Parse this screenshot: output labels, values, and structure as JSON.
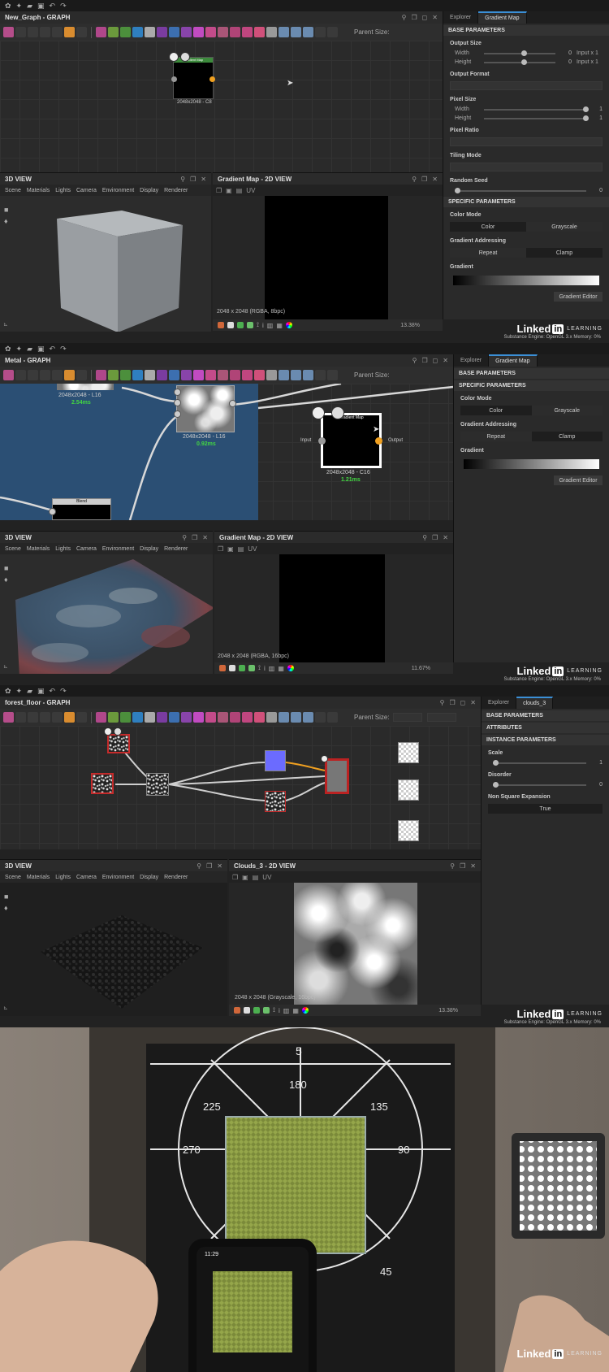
{
  "colors": {
    "accent": "#3b8fd6",
    "timing_green": "#43d643",
    "port_orange": "#f0a020",
    "graph_blue": "#2b4f74"
  },
  "frame1": {
    "graph_title": "New_Graph - GRAPH",
    "parent_size_label": "Parent Size:",
    "node": {
      "label": "2048x2048 - C8",
      "header": "Gradient Map"
    },
    "view3d": {
      "title": "3D VIEW",
      "menu": [
        "Scene",
        "Materials",
        "Lights",
        "Camera",
        "Environment",
        "Display",
        "Renderer"
      ]
    },
    "view2d": {
      "title": "Gradient Map - 2D VIEW",
      "uv": "UV",
      "info": "2048 x 2048 (RGBA, 8bpc)",
      "zoom": "13.38%"
    },
    "panel": {
      "tabs": [
        "Explorer",
        "Gradient Map"
      ],
      "base_params": "BASE PARAMETERS",
      "output_size": "Output Size",
      "width_label": "Width",
      "width_val": "0",
      "width_extra": "Input x 1",
      "height_label": "Height",
      "height_val": "0",
      "height_extra": "Input x 1",
      "output_format": "Output Format",
      "pixel_size": "Pixel Size",
      "px_width_val": "1",
      "px_height_val": "1",
      "pixel_ratio": "Pixel Ratio",
      "tiling_mode": "Tiling Mode",
      "random_seed": "Random Seed",
      "seed_val": "0",
      "specific_params": "SPECIFIC PARAMETERS",
      "color_mode": "Color Mode",
      "color": "Color",
      "grayscale": "Grayscale",
      "gradient_addressing": "Gradient Addressing",
      "repeat": "Repeat",
      "clamp": "Clamp",
      "gradient": "Gradient",
      "gradient_editor": "Gradient Editor"
    },
    "engine": "Substance Engine: OpenGL 3.x  Memory: 0%"
  },
  "frame2": {
    "graph_title": "Metal - GRAPH",
    "parent_size_label": "Parent Size:",
    "node_a_label": "2048x2048 - L16",
    "node_a_time": "2.54ms",
    "node_b_label": "2048x2048 - L16",
    "node_b_time": "0.92ms",
    "node_c_label": "2048x2048 - C16",
    "node_c_time": "1.21ms",
    "node_c_header": "Gradient Map",
    "input_label": "Input",
    "output_label": "Output",
    "blend_node": "Blend",
    "view3d": {
      "title": "3D VIEW",
      "menu": [
        "Scene",
        "Materials",
        "Lights",
        "Camera",
        "Environment",
        "Display",
        "Renderer"
      ]
    },
    "view2d": {
      "title": "Gradient Map - 2D VIEW",
      "uv": "UV",
      "info": "2048 x 2048 (RGBA, 16bpc)",
      "zoom": "11.67%"
    },
    "panel": {
      "tabs": [
        "Explorer",
        "Gradient Map"
      ],
      "base_params": "BASE PARAMETERS",
      "specific_params": "SPECIFIC PARAMETERS",
      "color_mode": "Color Mode",
      "color": "Color",
      "grayscale": "Grayscale",
      "gradient_addressing": "Gradient Addressing",
      "repeat": "Repeat",
      "clamp": "Clamp",
      "gradient": "Gradient",
      "gradient_editor": "Gradient Editor"
    },
    "engine": "Substance Engine: OpenGL 3.x  Memory: 0%"
  },
  "frame3": {
    "graph_title": "forest_floor - GRAPH",
    "parent_size_label": "Parent Size:",
    "view3d": {
      "title": "3D VIEW",
      "menu": [
        "Scene",
        "Materials",
        "Lights",
        "Camera",
        "Environment",
        "Display",
        "Renderer"
      ]
    },
    "view2d": {
      "title": "Clouds_3 - 2D VIEW",
      "uv": "UV",
      "info": "2048 x 2048 (Grayscale, 16bpc)",
      "zoom": "13.38%"
    },
    "panel": {
      "tabs": [
        "Explorer",
        "clouds_3"
      ],
      "base_params": "BASE PARAMETERS",
      "attributes": "ATTRIBUTES",
      "instance_params": "INSTANCE PARAMETERS",
      "scale": "Scale",
      "scale_val": "1",
      "disorder": "Disorder",
      "disorder_val": "0",
      "non_square": "Non Square Expansion",
      "non_square_val": "True"
    },
    "engine": "Substance Engine: OpenGL 3.x  Memory: 0%"
  },
  "frame4": {
    "phone_time": "11:29",
    "dial_numbers": [
      "5",
      "180",
      "225",
      "135",
      "270",
      "90",
      "45"
    ]
  },
  "branding": {
    "linked": "Linked",
    "in": "in",
    "learning": "LEARNING"
  }
}
